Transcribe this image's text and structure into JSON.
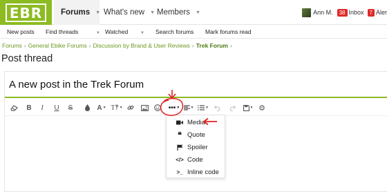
{
  "logo": {
    "text": "EBR"
  },
  "nav": {
    "tabs": [
      {
        "label": "Forums"
      },
      {
        "label": "What's new"
      },
      {
        "label": "Members"
      }
    ]
  },
  "user": {
    "name": "Ann M.",
    "inbox_count": "38",
    "inbox_label": "Inbox",
    "alerts_count": "7",
    "alerts_label": "Aler"
  },
  "subnav": {
    "items": [
      {
        "label": "New posts"
      },
      {
        "label": "Find threads"
      },
      {
        "label": "Watched"
      },
      {
        "label": "Search forums"
      },
      {
        "label": "Mark forums read"
      }
    ]
  },
  "breadcrumb": {
    "items": [
      {
        "label": "Forums"
      },
      {
        "label": "General Ebike Forums"
      },
      {
        "label": "Discussion by Brand & User Reviews"
      },
      {
        "label": "Trek Forum"
      }
    ]
  },
  "page": {
    "title": "Post thread"
  },
  "editor": {
    "title_value": "A new post in the Trek Forum",
    "more_label": "•••"
  },
  "dropdown": {
    "items": [
      {
        "label": "Media",
        "icon": "video-camera-icon"
      },
      {
        "label": "Quote",
        "icon": "quote-icon"
      },
      {
        "label": "Spoiler",
        "icon": "flag-icon"
      },
      {
        "label": "Code",
        "icon": "code-icon"
      },
      {
        "label": "Inline code",
        "icon": "terminal-icon"
      }
    ]
  },
  "colors": {
    "brand_green": "#8cbb22",
    "breadcrumb_green": "#6b9820",
    "annotation_red": "#e0201e",
    "badge_red": "#e02a2a"
  }
}
